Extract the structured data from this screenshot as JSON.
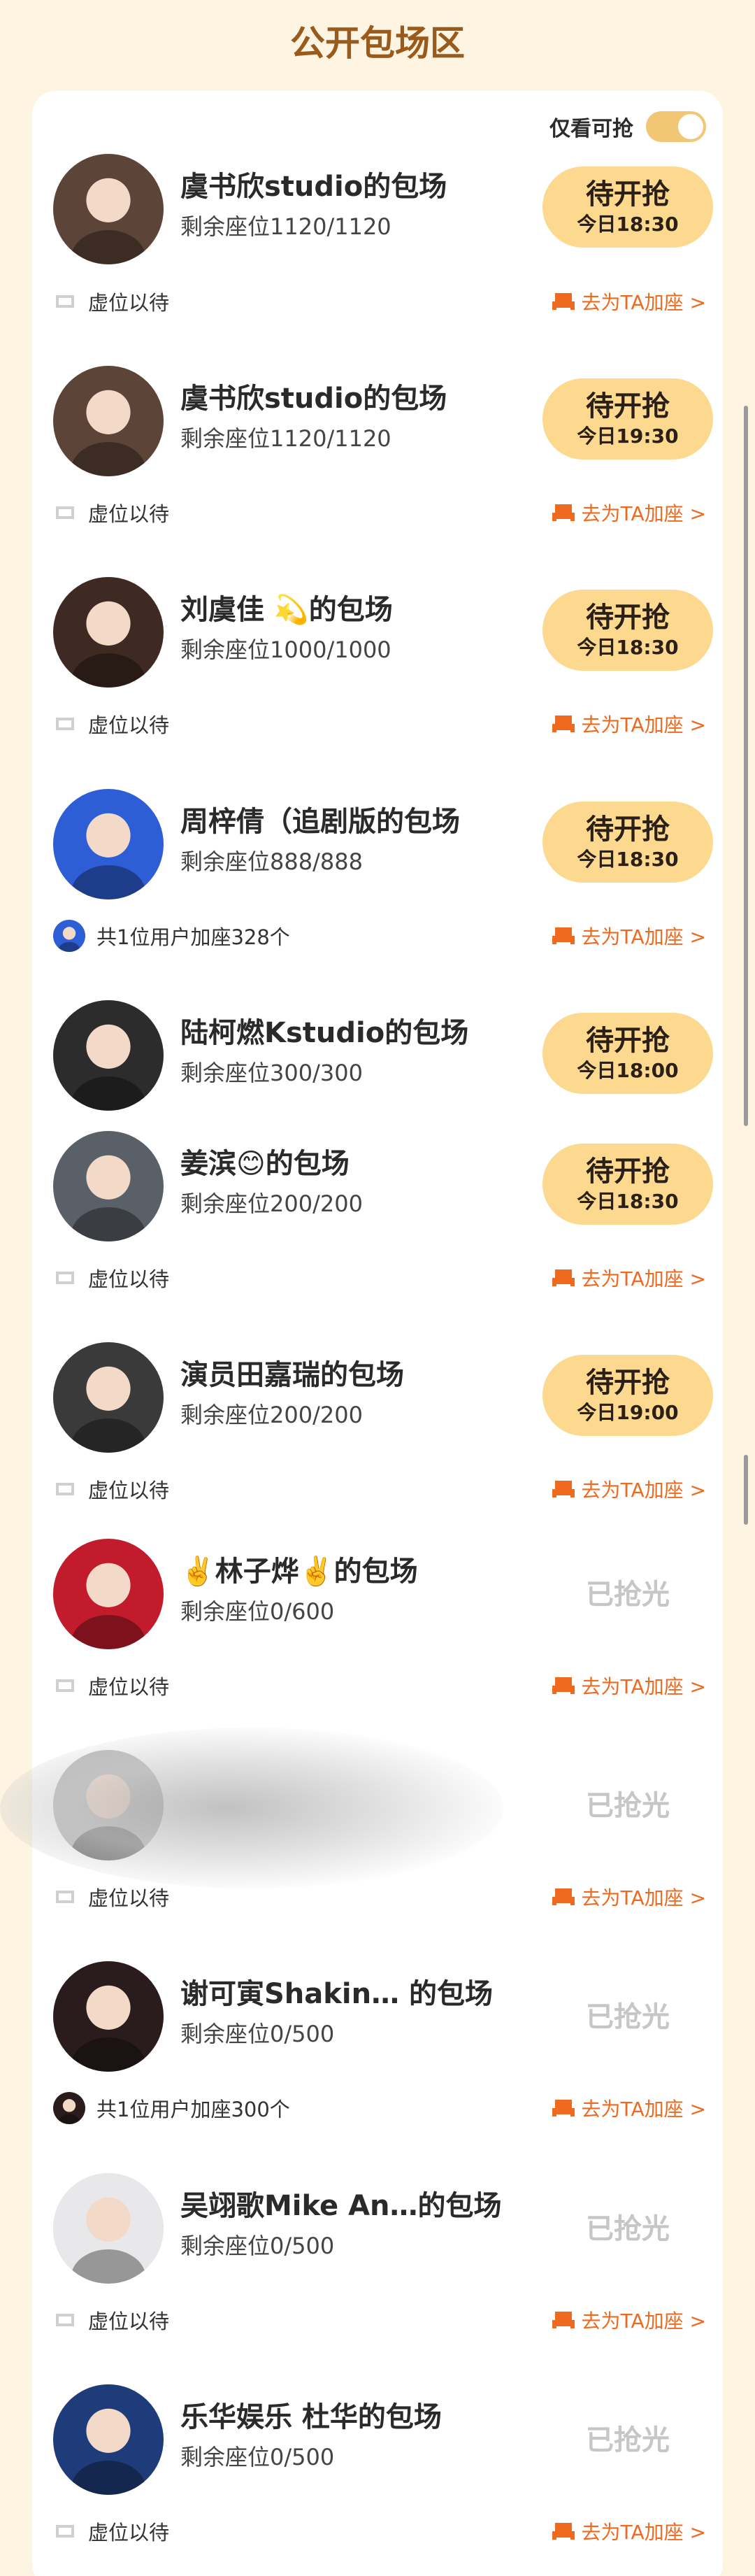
{
  "header": {
    "title": "公开包场区"
  },
  "filter": {
    "label": "仅看可抢",
    "enabled": true
  },
  "theme": {
    "accent": "#fcd98f",
    "link_color": "#ef6a1f",
    "title_color": "#9a5a1c",
    "soldout_color": "#c6c6c6"
  },
  "rows": [
    {
      "title": "虞书欣studio的包场",
      "seats": "剩余座位1120/1120",
      "status": "待开抢",
      "time": "今日18:30",
      "footer_text": "虚位以待",
      "link": "去为TA加座 >",
      "avatar_color": "#5c4438"
    },
    {
      "title": "虞书欣studio的包场",
      "seats": "剩余座位1120/1120",
      "status": "待开抢",
      "time": "今日19:30",
      "footer_text": "虚位以待",
      "link": "去为TA加座 >",
      "avatar_color": "#5c4438"
    },
    {
      "title": "刘虞佳 💫的包场",
      "seats": "剩余座位1000/1000",
      "status": "待开抢",
      "time": "今日18:30",
      "footer_text": "虚位以待",
      "link": "去为TA加座 >",
      "avatar_color": "#3e2a22"
    },
    {
      "title": "周梓倩（追剧版的包场",
      "seats": "剩余座位888/888",
      "status": "待开抢",
      "time": "今日18:30",
      "footer_text": "共1位用户加座328个",
      "link": "去为TA加座 >",
      "avatar_color": "#2d5ed6"
    },
    {
      "title": "陆柯燃Kstudio的包场",
      "seats": "剩余座位300/300",
      "status": "待开抢",
      "time": "今日18:00",
      "footer_text": "",
      "link": "",
      "avatar_color": "#2c2c2c"
    },
    {
      "title": "姜滨😊的包场",
      "seats": "剩余座位200/200",
      "status": "待开抢",
      "time": "今日18:30",
      "footer_text": "虚位以待",
      "link": "去为TA加座 >",
      "avatar_color": "#5a6068"
    },
    {
      "title": "演员田嘉瑞的包场",
      "seats": "剩余座位200/200",
      "status": "待开抢",
      "time": "今日19:00",
      "footer_text": "虚位以待",
      "link": "去为TA加座 >",
      "avatar_color": "#3a3a3a"
    },
    {
      "title": "✌️林子烨✌️的包场",
      "seats": "剩余座位0/600",
      "status": "已抢光",
      "time": "",
      "footer_text": "虚位以待",
      "link": "去为TA加座 >",
      "avatar_color": "#c21c2c"
    },
    {
      "title": "",
      "seats": "",
      "status": "已抢光",
      "time": "",
      "footer_text": "虚位以待",
      "link": "去为TA加座 >",
      "avatar_color": "#bcbcbc"
    },
    {
      "title": "谢可寅Shakin… 的包场",
      "seats": "剩余座位0/500",
      "status": "已抢光",
      "time": "",
      "footer_text": "共1位用户加座300个",
      "link": "去为TA加座 >",
      "avatar_color": "#2a1c1c"
    },
    {
      "title": "吴翊歌Mike An…的包场",
      "seats": "剩余座位0/500",
      "status": "已抢光",
      "time": "",
      "footer_text": "虚位以待",
      "link": "去为TA加座 >",
      "avatar_color": "#e8e8ea"
    },
    {
      "title": "乐华娱乐 杜华的包场",
      "seats": "剩余座位0/500",
      "status": "已抢光",
      "time": "",
      "footer_text": "虚位以待",
      "link": "去为TA加座 >",
      "avatar_color": "#1f3c7a"
    }
  ]
}
